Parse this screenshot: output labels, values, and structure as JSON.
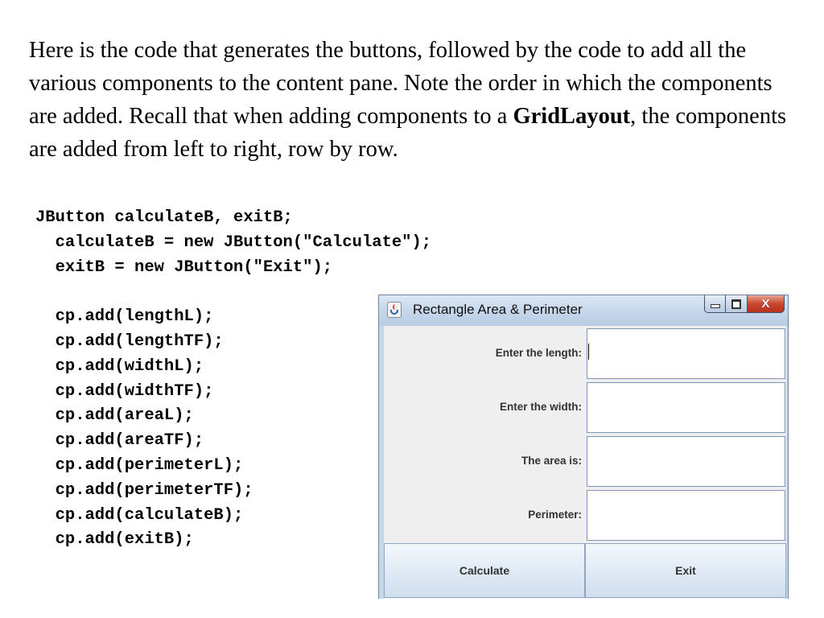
{
  "text": {
    "para_part1": "Here is the code that generates the buttons, followed by the code to add all the various components to the content pane.  Note the order in which the components are added.  Recall that when adding components to a ",
    "para_bold": "GridLayout",
    "para_part2": ", the components are added from left to right, row by row."
  },
  "code": {
    "line1": "JButton calculateB, exitB;",
    "line2": "  calculateB = new JButton(\"Calculate\");",
    "line3": "  exitB = new JButton(\"Exit\");",
    "adds": [
      "  cp.add(lengthL);",
      "  cp.add(lengthTF);",
      "  cp.add(widthL);",
      "  cp.add(widthTF);",
      "  cp.add(areaL);",
      "  cp.add(areaTF);",
      "  cp.add(perimeterL);",
      "  cp.add(perimeterTF);",
      "  cp.add(calculateB);",
      "  cp.add(exitB);"
    ]
  },
  "window": {
    "title": "Rectangle Area & Perimeter",
    "icon": "java-cup-icon",
    "controls": [
      "minimize-icon",
      "maximize-icon",
      "close-icon"
    ],
    "close_glyph": "X",
    "rows": [
      {
        "label": "Enter the length:",
        "value": ""
      },
      {
        "label": "Enter the width:",
        "value": ""
      },
      {
        "label": "The area is:",
        "value": ""
      },
      {
        "label": "Perimeter:",
        "value": ""
      }
    ],
    "buttons": {
      "calculate": "Calculate",
      "exit": "Exit"
    }
  },
  "colors": {
    "titlebar": "#c5d6ea",
    "close_button": "#c9462f",
    "panel_bg": "#efefef"
  }
}
